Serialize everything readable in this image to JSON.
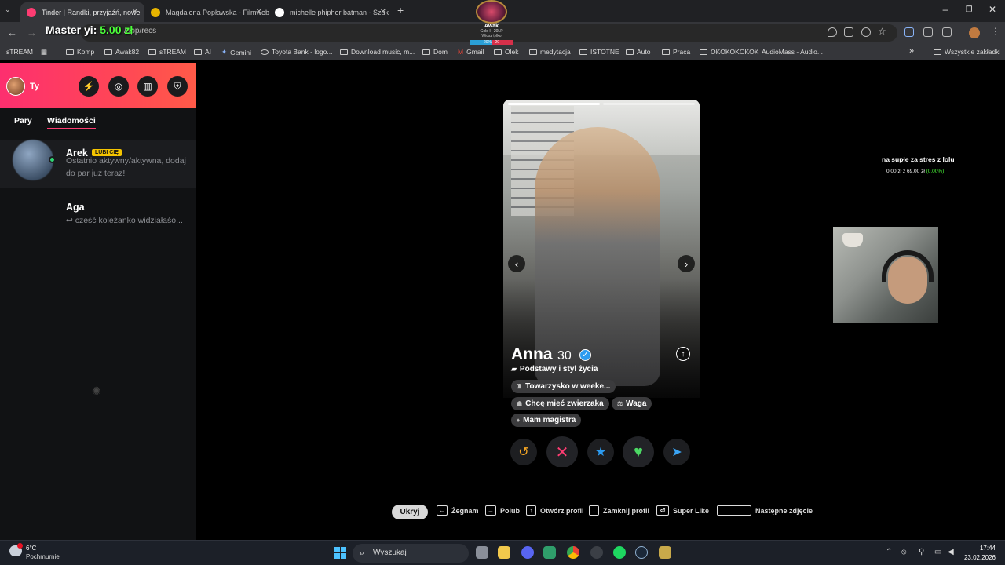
{
  "browser": {
    "tabs": [
      {
        "title": "Tinder | Randki, przyjaźń, nowe",
        "active": true
      },
      {
        "title": "Magdalena Popławska - Filmweb",
        "active": false
      },
      {
        "title": "michelle phipher batman - Szuk",
        "active": false
      }
    ],
    "new_tab": "+",
    "url": "/app/recs",
    "bookmarks": [
      "sTREAM",
      "Komp",
      "Awak82",
      "sTREAM",
      "AI",
      "Gemini",
      "Toyota Bank - logo...",
      "Download music, m...",
      "Dom",
      "Gmail",
      "Olek",
      "medytacja",
      "ISTOTNE",
      "Auto",
      "Praca",
      "OKOKOKOKOK",
      "AudioMass - Audio..."
    ],
    "bookmarks_more": "»",
    "all_bookmarks": "Wszystkie zakładki"
  },
  "stream_overlay": {
    "master_label": "Master yi:",
    "master_amount": "5.00 zł",
    "badge_name": "Awak",
    "badge_rank": "Gold I",
    "badge_lp": "20LP",
    "badge_sub": "Wicsz tylko",
    "badge_bar": "20% · 20",
    "donate_title": "na supłe za stres z lolu",
    "donate_amount": "0,00 zł z 69,00 zł",
    "donate_pct": "(0.00%)"
  },
  "sidebar": {
    "user": "Ty",
    "tabs": [
      "Pary",
      "Wiadomości"
    ],
    "active_tab": "Wiadomości",
    "conversations": [
      {
        "name": "Arek",
        "badge": "LUBI CIĘ",
        "message": "Ostatnio aktywny/aktywna, dodaj do par już teraz!"
      },
      {
        "name": "Aga",
        "message": "↩ cześć koleżanko widziałaśo..."
      }
    ]
  },
  "profile": {
    "name": "Anna",
    "age": "30",
    "section": "Podstawy i styl życia",
    "chips": [
      "Towarzysko w weeke...",
      "Chcę mieć zwierzaka",
      "Waga",
      "Mam magistra"
    ],
    "photo_count": 2,
    "photo_current": 1
  },
  "actions": {
    "rewind_icon": "↺",
    "nope_icon": "✕",
    "superlike_icon": "★",
    "like_icon": "♥",
    "boost_icon": "➤"
  },
  "hints": {
    "hide": "Ukryj",
    "nope": "Żegnam",
    "like": "Polub",
    "open_profile": "Otwórz profil",
    "close_profile": "Zamknij profil",
    "super_like": "Super Like",
    "next_photo": "Następne zdjęcie"
  },
  "taskbar": {
    "temp": "6°C",
    "weather": "Pochmurnie",
    "search": "Wyszukaj",
    "time": "17:44",
    "date": "23.02.2026"
  },
  "colors": {
    "tinder_gradient_start": "#fd2f6f",
    "tinder_gradient_end": "#ff5a48",
    "online": "#2ed573",
    "badge": "#f5c400",
    "nope": "#fe3c72",
    "superlike": "#2c9bf0",
    "like": "#4cd964"
  }
}
